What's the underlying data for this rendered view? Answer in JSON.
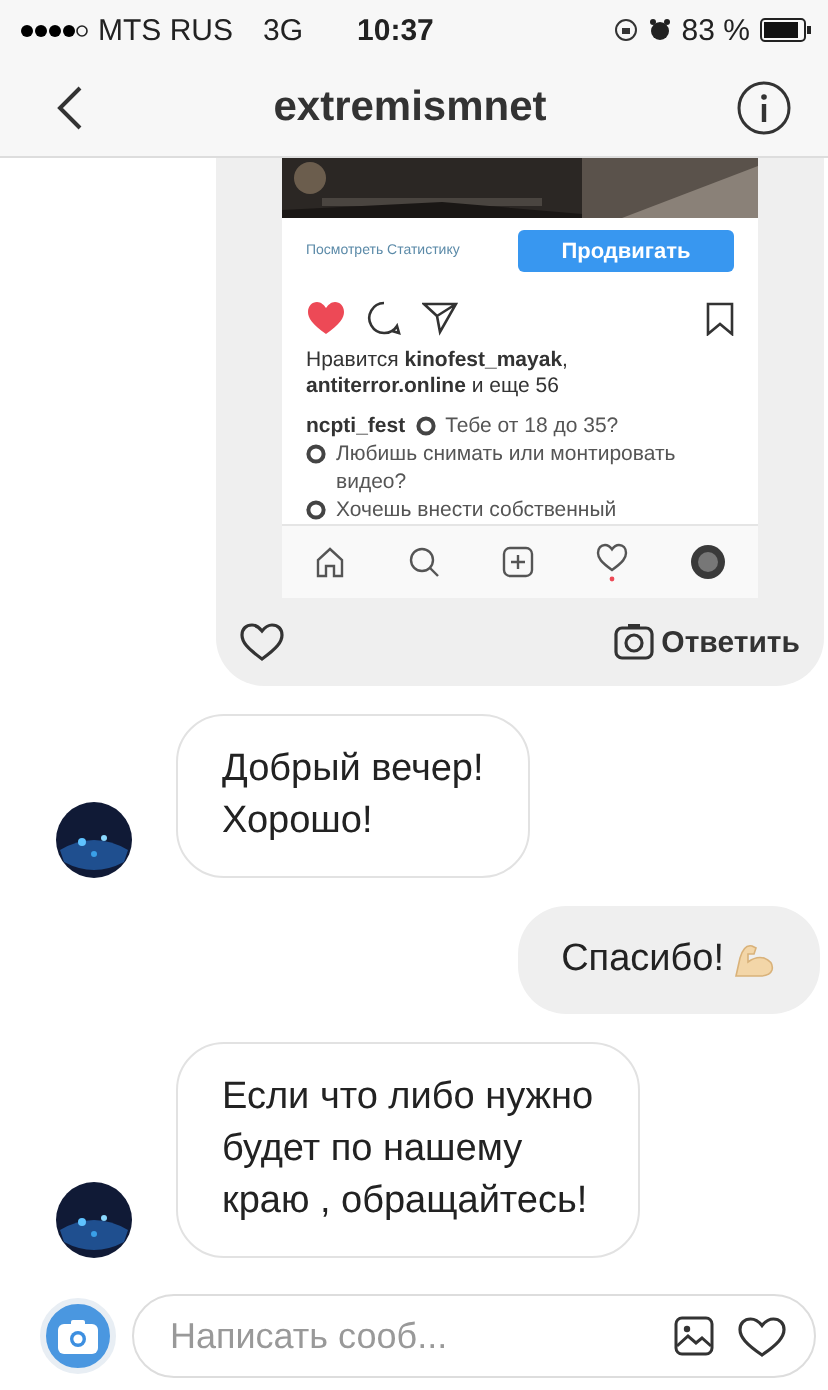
{
  "status_bar": {
    "carrier": "MTS RUS",
    "network": "3G",
    "time": "10:37",
    "battery": "83 %"
  },
  "header": {
    "title": "extremismnet"
  },
  "shared_post": {
    "stats_link": "Посмотреть Статистику",
    "promote_button": "Продвигать",
    "liked": true,
    "likes": "Нравится **kinofest_mayak**, **antiterror.online** и еще 56",
    "caption_user": "ncpti_fest",
    "caption_lines": [
      "Тебе от 18 до 35?",
      "Любишь снимать или монтировать видео?",
      "Хочешь внести собственный"
    ],
    "reply": "Ответить"
  },
  "messages": [
    {
      "kind": "incoming",
      "text": "Добрый вечер!\nХорошо!",
      "avatar": true
    },
    {
      "kind": "outgoing",
      "text": "Спасибо!",
      "emoji": true
    },
    {
      "kind": "incoming",
      "text": "Если что либо нужно\nбудет по нашему\nкраю , обращайтесь!",
      "avatar": true
    }
  ],
  "composer": {
    "placeholder": "Написать сооб..."
  }
}
